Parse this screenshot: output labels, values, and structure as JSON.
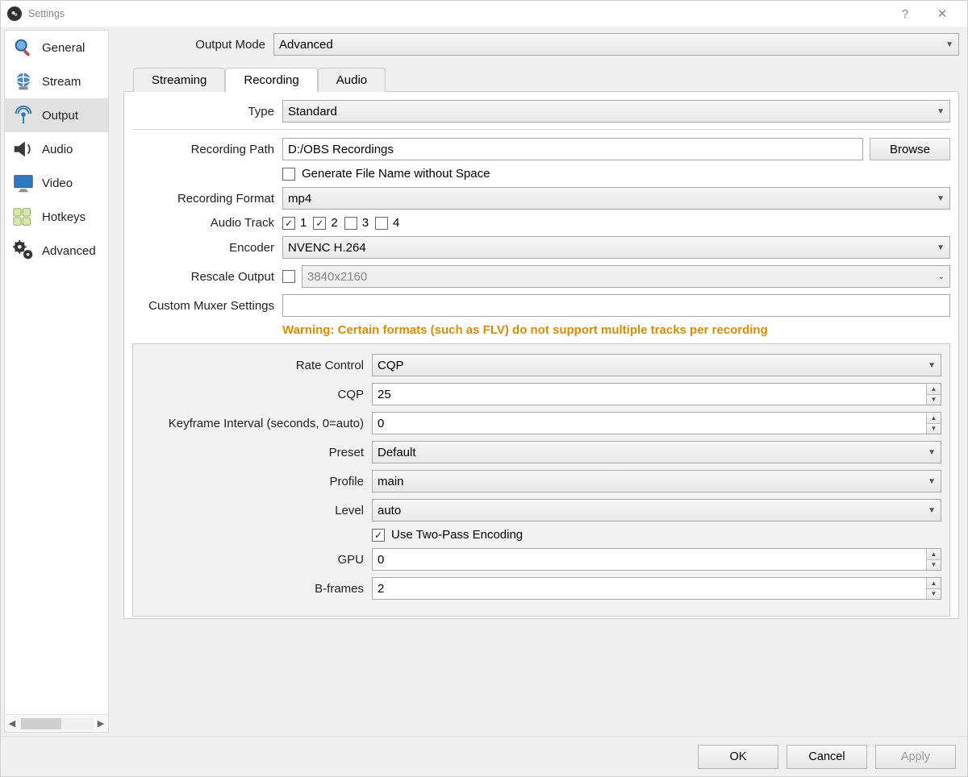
{
  "window": {
    "title": "Settings"
  },
  "sidebar": {
    "items": [
      {
        "label": "General"
      },
      {
        "label": "Stream"
      },
      {
        "label": "Output"
      },
      {
        "label": "Audio"
      },
      {
        "label": "Video"
      },
      {
        "label": "Hotkeys"
      },
      {
        "label": "Advanced"
      }
    ]
  },
  "header": {
    "output_mode_label": "Output Mode",
    "output_mode_value": "Advanced"
  },
  "tabs": {
    "streaming": "Streaming",
    "recording": "Recording",
    "audio": "Audio"
  },
  "recording": {
    "type_label": "Type",
    "type_value": "Standard",
    "path_label": "Recording Path",
    "path_value": "D:/OBS Recordings",
    "browse": "Browse",
    "gen_no_space": "Generate File Name without Space",
    "format_label": "Recording Format",
    "format_value": "mp4",
    "audio_track_label": "Audio Track",
    "tracks": {
      "t1": "1",
      "t2": "2",
      "t3": "3",
      "t4": "4"
    },
    "encoder_label": "Encoder",
    "encoder_value": "NVENC H.264",
    "rescale_label": "Rescale Output",
    "rescale_value": "3840x2160",
    "muxer_label": "Custom Muxer Settings",
    "muxer_value": "",
    "warning": "Warning: Certain formats (such as FLV) do not support multiple tracks per recording"
  },
  "encoder": {
    "rate_control_label": "Rate Control",
    "rate_control_value": "CQP",
    "cqp_label": "CQP",
    "cqp_value": "25",
    "keyframe_label": "Keyframe Interval (seconds, 0=auto)",
    "keyframe_value": "0",
    "preset_label": "Preset",
    "preset_value": "Default",
    "profile_label": "Profile",
    "profile_value": "main",
    "level_label": "Level",
    "level_value": "auto",
    "twopass": "Use Two-Pass Encoding",
    "gpu_label": "GPU",
    "gpu_value": "0",
    "bframes_label": "B-frames",
    "bframes_value": "2"
  },
  "buttons": {
    "ok": "OK",
    "cancel": "Cancel",
    "apply": "Apply"
  }
}
